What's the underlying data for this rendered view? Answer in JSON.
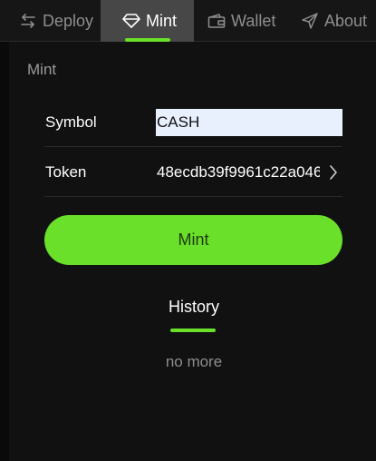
{
  "tabs": {
    "deploy": {
      "label": "Deploy",
      "icon": "swap-arrows-icon"
    },
    "mint": {
      "label": "Mint",
      "icon": "diamond-icon",
      "active": true
    },
    "wallet": {
      "label": "Wallet",
      "icon": "wallet-icon"
    },
    "about": {
      "label": "About",
      "icon": "send-arrow-icon"
    }
  },
  "section_title": "Mint",
  "form": {
    "symbol_label": "Symbol",
    "symbol_value": "CASH",
    "token_label": "Token",
    "token_value": "48ecdb39f9961c22a046"
  },
  "mint_button_label": "Mint",
  "history": {
    "title": "History",
    "empty_text": "no more"
  },
  "colors": {
    "accent": "#6ae02a",
    "background": "#111111",
    "active_tab": "#474747",
    "input_bg": "#e8f0fe"
  }
}
